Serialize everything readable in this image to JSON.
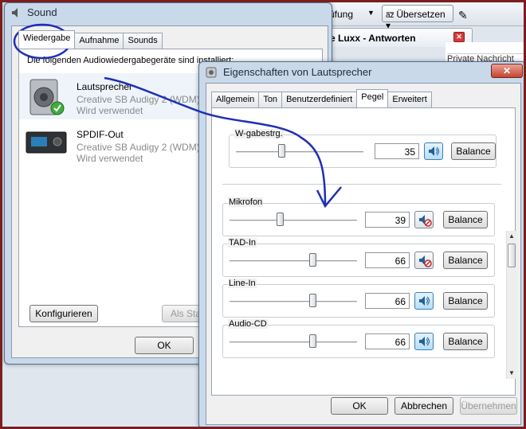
{
  "browser": {
    "toolbar_text": "rüfung",
    "translate_label": "Übersetzen",
    "tab_title": "e Luxx - Antworten",
    "right_line1": "Private Nachricht"
  },
  "sound": {
    "title": "Sound",
    "tabs": [
      "Wiedergabe",
      "Aufnahme",
      "Sounds"
    ],
    "description": "Die folgenden Audiowiedergabegeräte sind installiert:",
    "devices": [
      {
        "name": "Lautsprecher",
        "driver": "Creative SB Audigy 2 (WDM)",
        "status": "Wird verwendet"
      },
      {
        "name": "SPDIF-Out",
        "driver": "Creative SB Audigy 2 (WDM)",
        "status": "Wird verwendet"
      }
    ],
    "configure_label": "Konfigurieren",
    "default_label": "Als Sta",
    "ok_label": "OK"
  },
  "props": {
    "title": "Eigenschaften von Lautsprecher",
    "close": "✕",
    "tabs": [
      "Allgemein",
      "Ton",
      "Benutzerdefiniert",
      "Pegel",
      "Erweitert"
    ],
    "balance_label": "Balance",
    "channels": [
      {
        "label": "W-gabestrg.",
        "value": "35",
        "level": 0.35,
        "muted": false
      },
      {
        "label": "Mikrofon",
        "value": "39",
        "level": 0.39,
        "muted": true
      },
      {
        "label": "TAD-In",
        "value": "66",
        "level": 0.66,
        "muted": true
      },
      {
        "label": "Line-In",
        "value": "66",
        "level": 0.66,
        "muted": false
      },
      {
        "label": "Audio-CD",
        "value": "66",
        "level": 0.66,
        "muted": false
      }
    ],
    "ok_label": "OK",
    "cancel_label": "Abbrechen",
    "apply_label": "Übernehmen"
  },
  "colors": {
    "annotation": "#1f2fb5",
    "accent_border": "#3c7fb1"
  }
}
